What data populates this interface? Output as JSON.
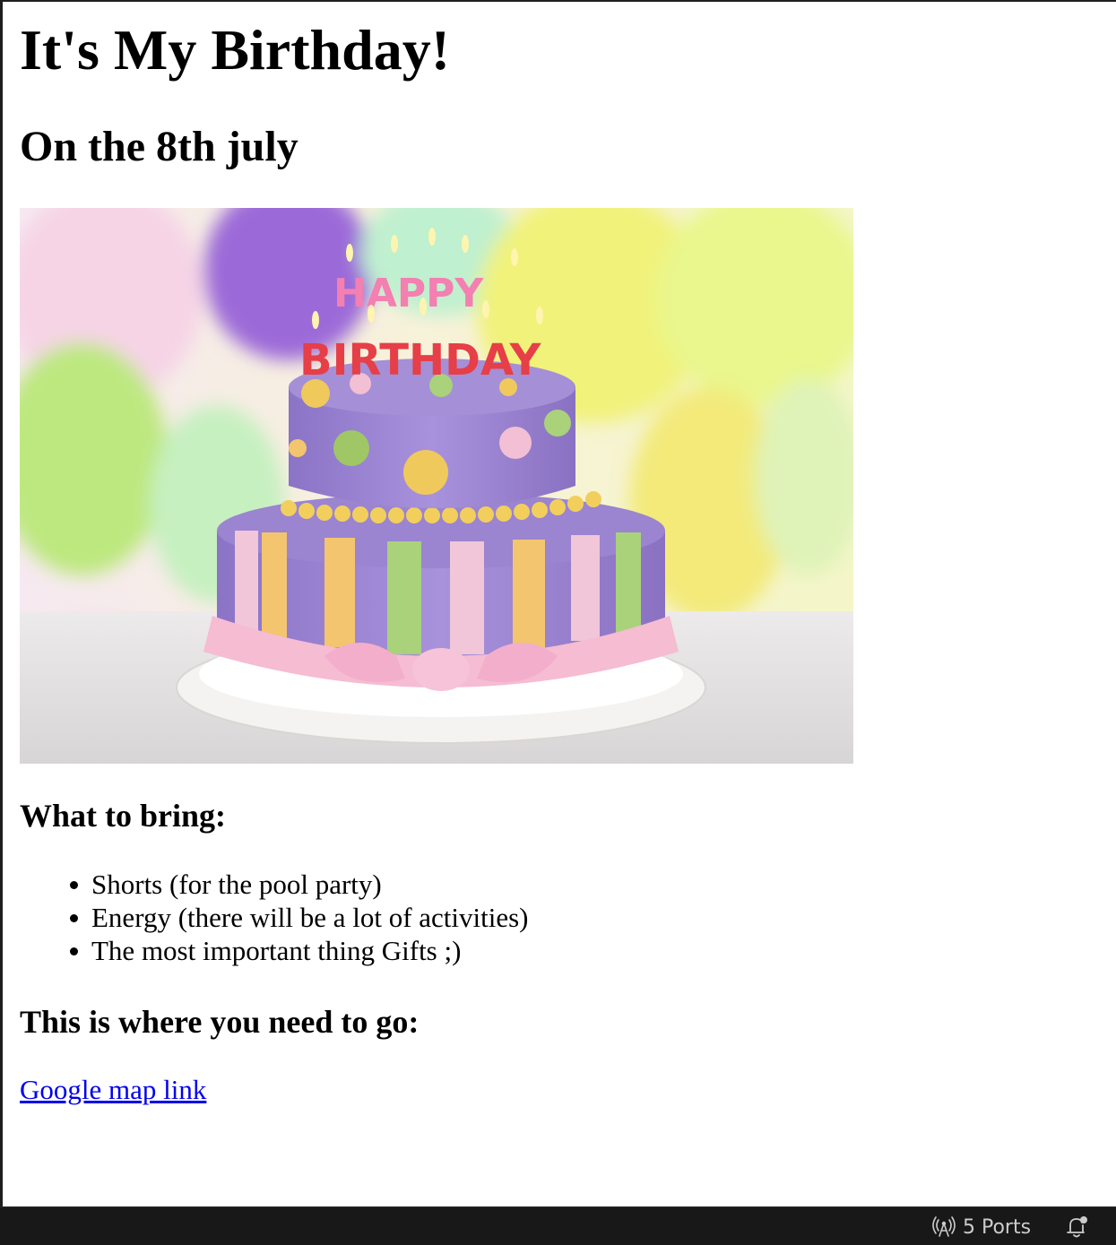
{
  "page": {
    "title": "It's My Birthday!",
    "subtitle": "On the 8th july",
    "image": {
      "description_icon": "birthday-cake-image",
      "letters_top": "HAPPY",
      "letters_bottom": "BIRTHDAY"
    },
    "bring_heading": "What to bring:",
    "bring_items": [
      "Shorts (for the pool party)",
      "Energy (there will be a lot of activities)",
      "The most important thing Gifts ;)"
    ],
    "where_heading": "This is where you need to go:",
    "map_link": "Google map link"
  },
  "statusbar": {
    "ports_label": "5 Ports",
    "ports_icon": "broadcast-icon",
    "notifications_icon": "bell-icon"
  },
  "colors": {
    "link": "#0000ee",
    "statusbar_bg": "#181818",
    "statusbar_text": "#cccccc"
  }
}
